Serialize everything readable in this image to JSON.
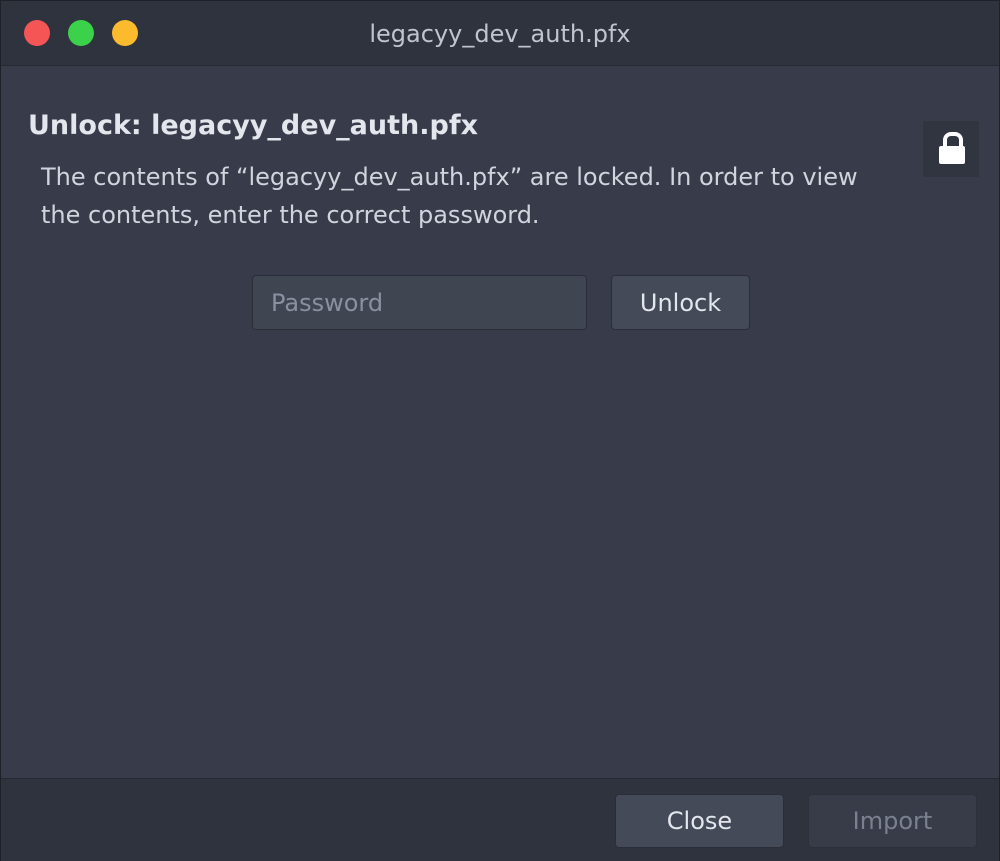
{
  "window": {
    "title": "legacyy_dev_auth.pfx"
  },
  "dialog": {
    "heading": "Unlock: legacyy_dev_auth.pfx",
    "message": "The contents of “legacyy_dev_auth.pfx” are locked. In order to view the contents, enter the correct password.",
    "lock_icon": "lock-icon"
  },
  "form": {
    "password_value": "",
    "password_placeholder": "Password",
    "unlock_label": "Unlock"
  },
  "footer": {
    "close_label": "Close",
    "import_label": "Import"
  },
  "colors": {
    "close_dot": "#f55555",
    "zoom_dot": "#3bd14a",
    "minimize_dot": "#fbbb2c",
    "background": "#383c4a"
  }
}
